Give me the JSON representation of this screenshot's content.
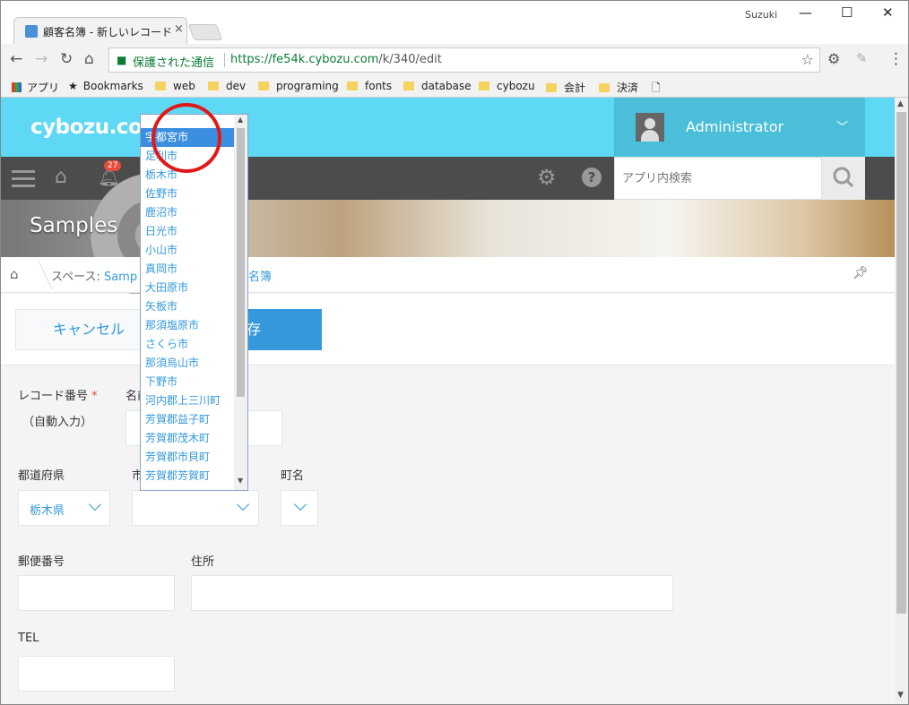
{
  "browser": {
    "tab_title": "顧客名簿 - 新しいレコード",
    "tab_close": "×",
    "profile": "Suzuki",
    "win_min": "—",
    "win_max": "☐",
    "win_close": "✕",
    "secure_label": "保護された通信",
    "url_host": "https://fe54k.cybozu.com",
    "url_path": "/k/340/edit",
    "bookmarks": [
      "アプリ",
      "Bookmarks",
      "web",
      "dev",
      "programing",
      "fonts",
      "database",
      "cybozu",
      "会計",
      "決済"
    ]
  },
  "header": {
    "logo": "cybozu.com",
    "user": "Administrator",
    "notification_count": "27",
    "search_placeholder": "アプリ内検索"
  },
  "banner": {
    "title": "Samples"
  },
  "breadcrumb": {
    "prefix": "スペース: ",
    "space": "Samp",
    "app": "名簿"
  },
  "actions": {
    "cancel": "キャンセル",
    "save": "保存"
  },
  "form": {
    "record_no_label": "レコード番号",
    "required_mark": "*",
    "record_no_value": "（自動入力）",
    "name_label": "名前",
    "pref_label": "都道府県",
    "pref_value": "栃木県",
    "city_label": "市",
    "town_label": "町名",
    "zip_label": "郵便番号",
    "address_label": "住所",
    "tel_label": "TEL"
  },
  "city_options": [
    "宇都宮市",
    "足利市",
    "栃木市",
    "佐野市",
    "鹿沼市",
    "日光市",
    "小山市",
    "真岡市",
    "大田原市",
    "矢板市",
    "那須塩原市",
    "さくら市",
    "那須烏山市",
    "下野市",
    "河内郡上三川町",
    "芳賀郡益子町",
    "芳賀郡茂木町",
    "芳賀郡市貝町",
    "芳賀郡芳賀町"
  ],
  "city_selected": "宇都宮市"
}
